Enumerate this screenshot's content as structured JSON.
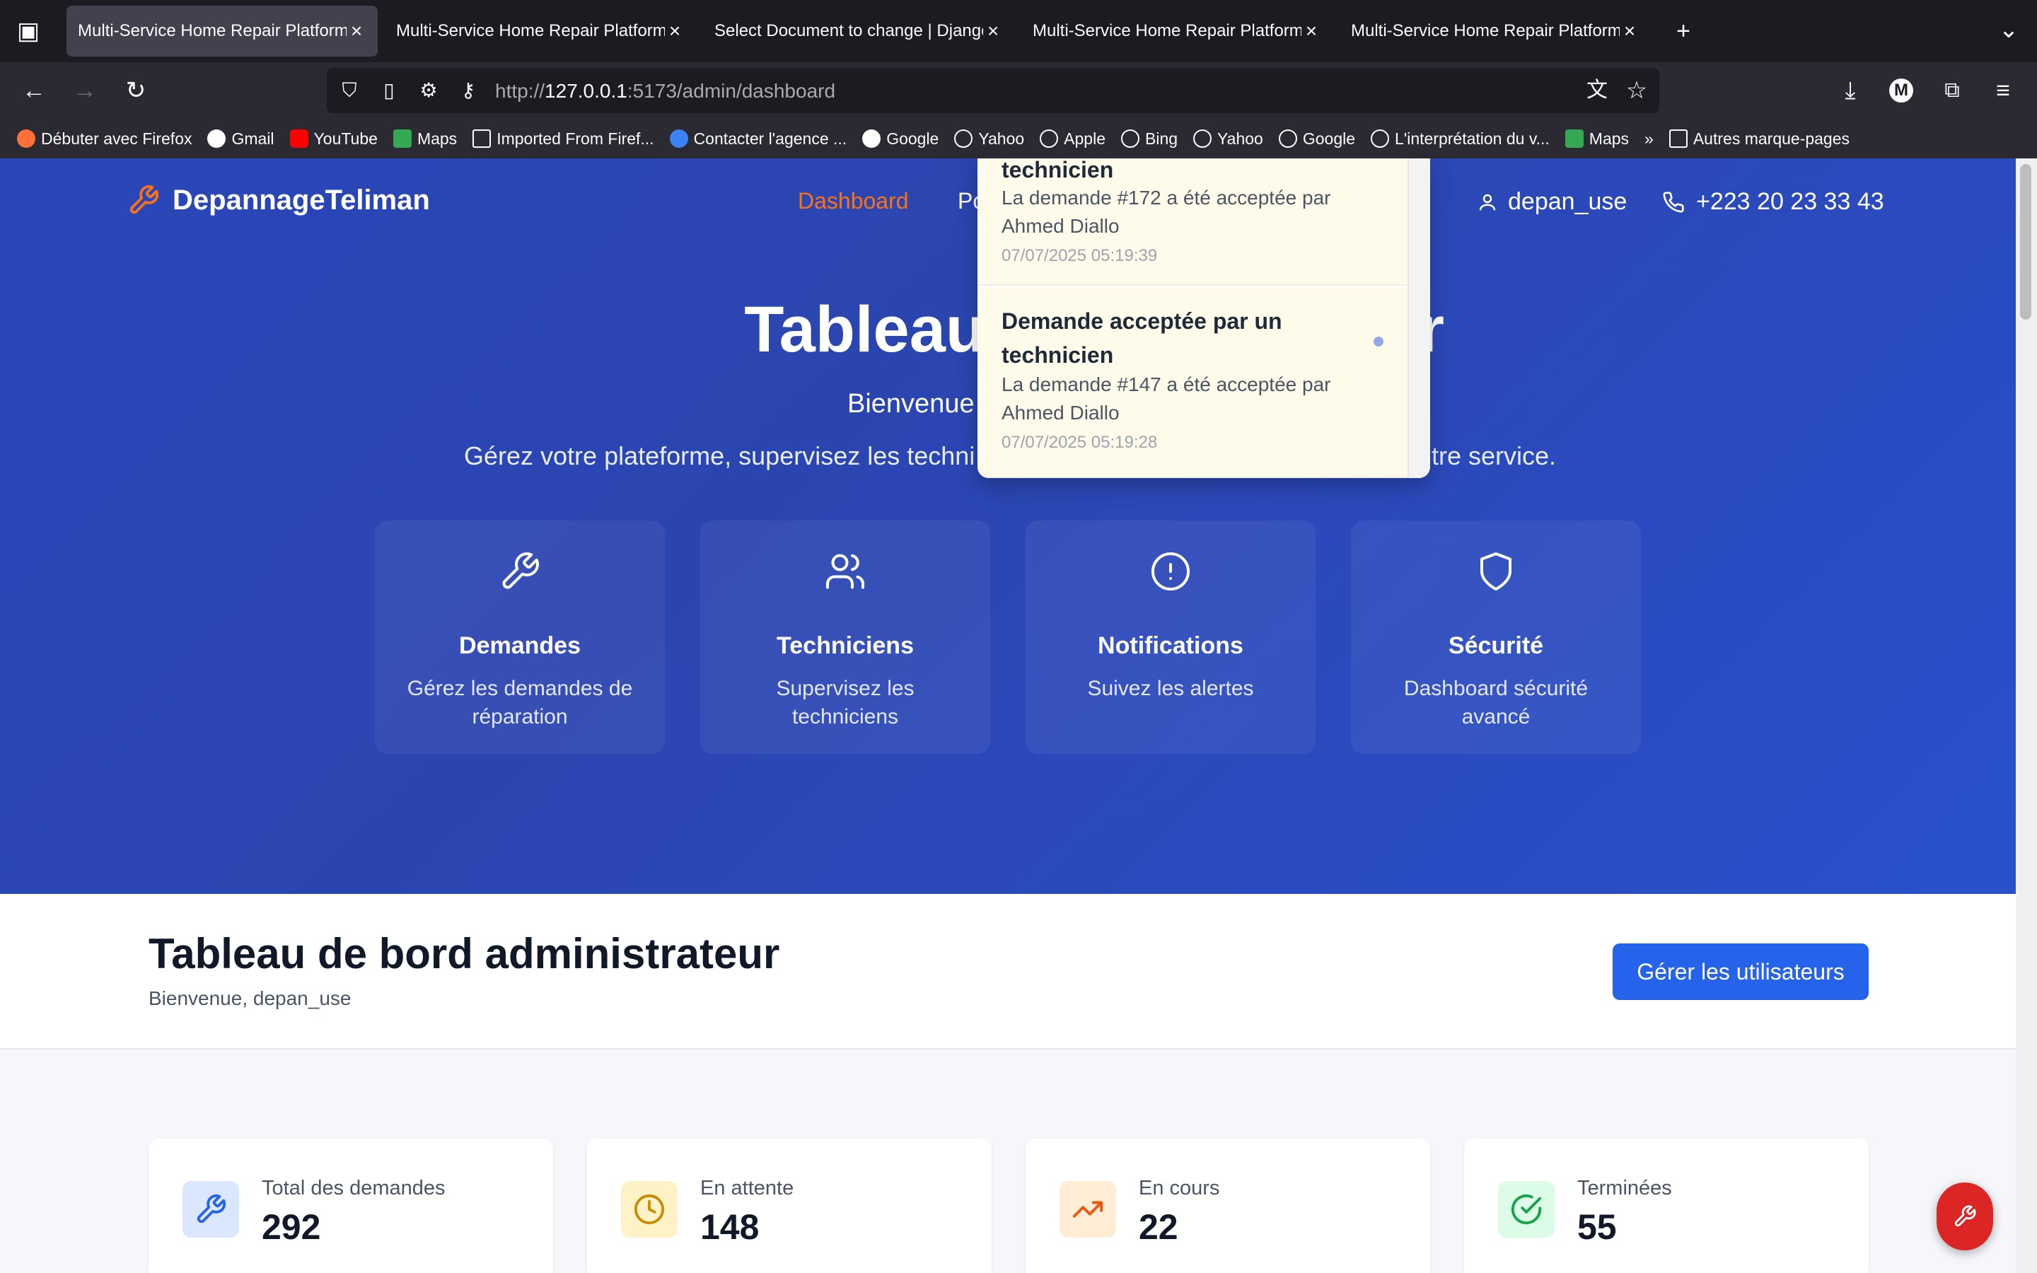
{
  "browser": {
    "tabs": [
      {
        "title": "Multi-Service Home Repair Platform"
      },
      {
        "title": "Multi-Service Home Repair Platform"
      },
      {
        "title": "Select Document to change | Django"
      },
      {
        "title": "Multi-Service Home Repair Platform"
      },
      {
        "title": "Multi-Service Home Repair Platform"
      }
    ],
    "url_prefix": "http://",
    "url_host": "127.0.0.1",
    "url_rest": ":5173/admin/dashboard",
    "bookmarks": [
      {
        "label": "Débuter avec Firefox"
      },
      {
        "label": "Gmail"
      },
      {
        "label": "YouTube"
      },
      {
        "label": "Maps"
      },
      {
        "label": "Imported From Firef..."
      },
      {
        "label": "Contacter l'agence ..."
      },
      {
        "label": "Google"
      },
      {
        "label": "Yahoo"
      },
      {
        "label": "Apple"
      },
      {
        "label": "Bing"
      },
      {
        "label": "Yahoo"
      },
      {
        "label": "Google"
      },
      {
        "label": "L'interprétation du v..."
      },
      {
        "label": "Maps"
      }
    ],
    "other_bookmarks": "Autres marque-pages",
    "profile_letter": "M"
  },
  "nav": {
    "brand": "DepannageTeliman",
    "dashboard": "Dashboard",
    "partial": "Po",
    "user": "depan_use",
    "phone": "+223 20 23 33 43"
  },
  "hero": {
    "title_left": "Tableau de Bor",
    "title_right": "ur",
    "sub1": "Bienvenue",
    "sub2_left": "Gérez votre plateforme, supervisez les techni",
    "sub2_right": "tre service."
  },
  "features": [
    {
      "title": "Demandes",
      "desc": "Gérez les demandes de réparation"
    },
    {
      "title": "Techniciens",
      "desc": "Supervisez les techniciens"
    },
    {
      "title": "Notifications",
      "desc": "Suivez les alertes"
    },
    {
      "title": "Sécurité",
      "desc": "Dashboard sécurité avancé"
    }
  ],
  "notifications": [
    {
      "title": "technicien",
      "message": "La demande #172 a été acceptée par Ahmed Diallo",
      "date": "07/07/2025 05:19:39"
    },
    {
      "title": "Demande acceptée par un technicien",
      "message": "La demande #147 a été acceptée par Ahmed Diallo",
      "date": "07/07/2025 05:19:28"
    }
  ],
  "admin": {
    "title": "Tableau de bord administrateur",
    "welcome": "Bienvenue, depan_use",
    "manage_users": "Gérer les utilisateurs"
  },
  "stats": [
    {
      "label": "Total des demandes",
      "value": "292",
      "color": "#2563eb",
      "bg": "#dbe7fe"
    },
    {
      "label": "En attente",
      "value": "148",
      "color": "#ca8a04",
      "bg": "#fef3c7"
    },
    {
      "label": "En cours",
      "value": "22",
      "color": "#ea580c",
      "bg": "#ffedd5"
    },
    {
      "label": "Terminées",
      "value": "55",
      "color": "#16a34a",
      "bg": "#dcfce7"
    }
  ]
}
